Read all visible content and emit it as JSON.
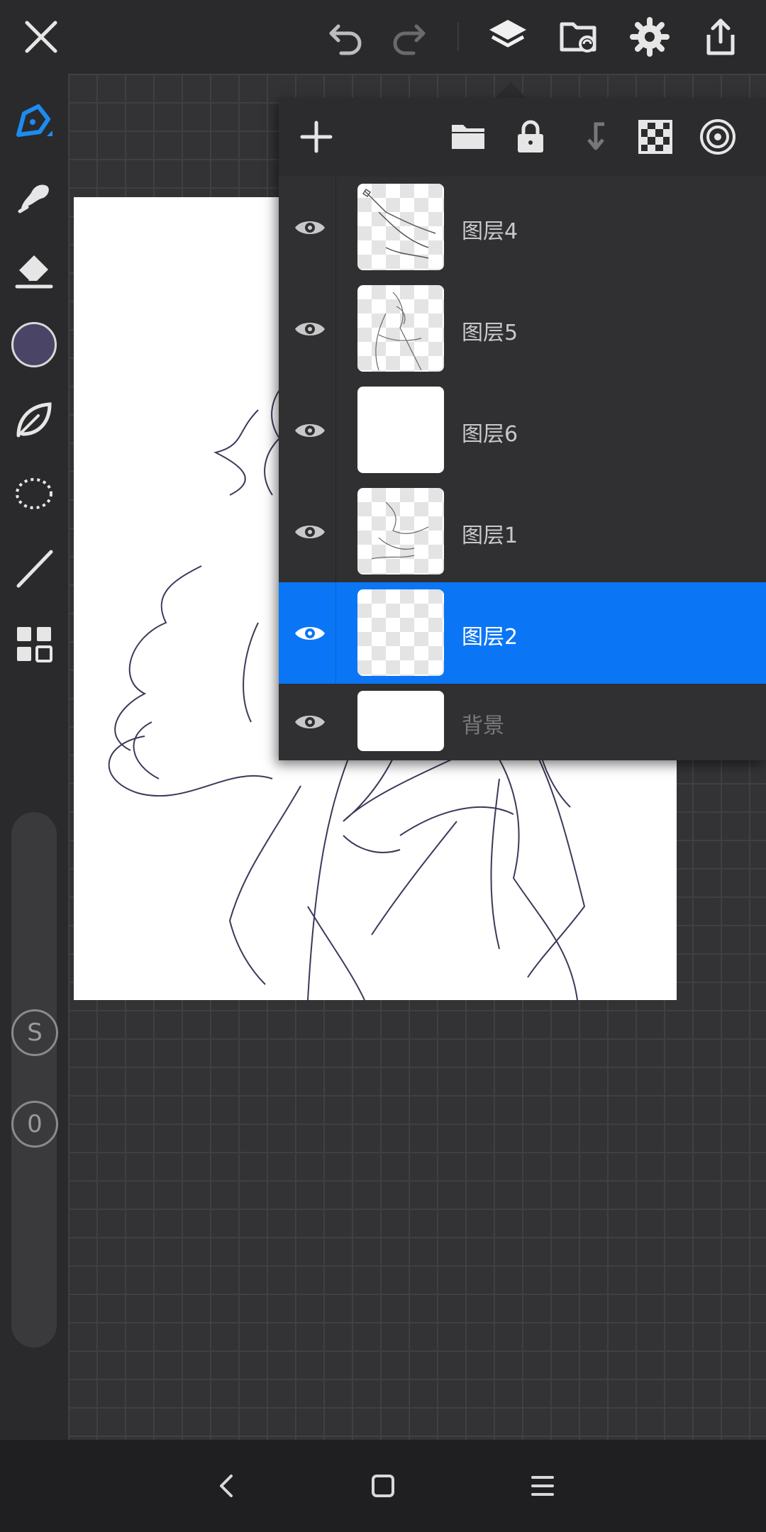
{
  "toolbar": {
    "close": "close-icon",
    "undo": "undo-icon",
    "redo": "redo-icon",
    "layers": "layers-icon",
    "gallery": "folder-sync-icon",
    "settings": "gear-icon",
    "share": "share-icon"
  },
  "tools": [
    "pen",
    "smudge",
    "eraser",
    "color",
    "blend",
    "lasso",
    "line",
    "gallery-grid"
  ],
  "current_color": "#4a4466",
  "brush_size_label": "S",
  "opacity_label": "0",
  "layers_panel": {
    "actions": [
      "add-icon",
      "folder-icon",
      "lock-icon",
      "merge-down-icon",
      "transparency-icon",
      "blend-icon"
    ],
    "layers": [
      {
        "name": "图层4",
        "visible": true,
        "selected": false
      },
      {
        "name": "图层5",
        "visible": true,
        "selected": false
      },
      {
        "name": "图层6",
        "visible": true,
        "selected": false
      },
      {
        "name": "图层1",
        "visible": true,
        "selected": false
      },
      {
        "name": "图层2",
        "visible": true,
        "selected": true
      },
      {
        "name": "背景",
        "visible": true,
        "selected": false
      }
    ]
  },
  "colors": {
    "accent": "#0a76f5",
    "background": "#2e2e30",
    "panel": "#2c2c2e"
  }
}
